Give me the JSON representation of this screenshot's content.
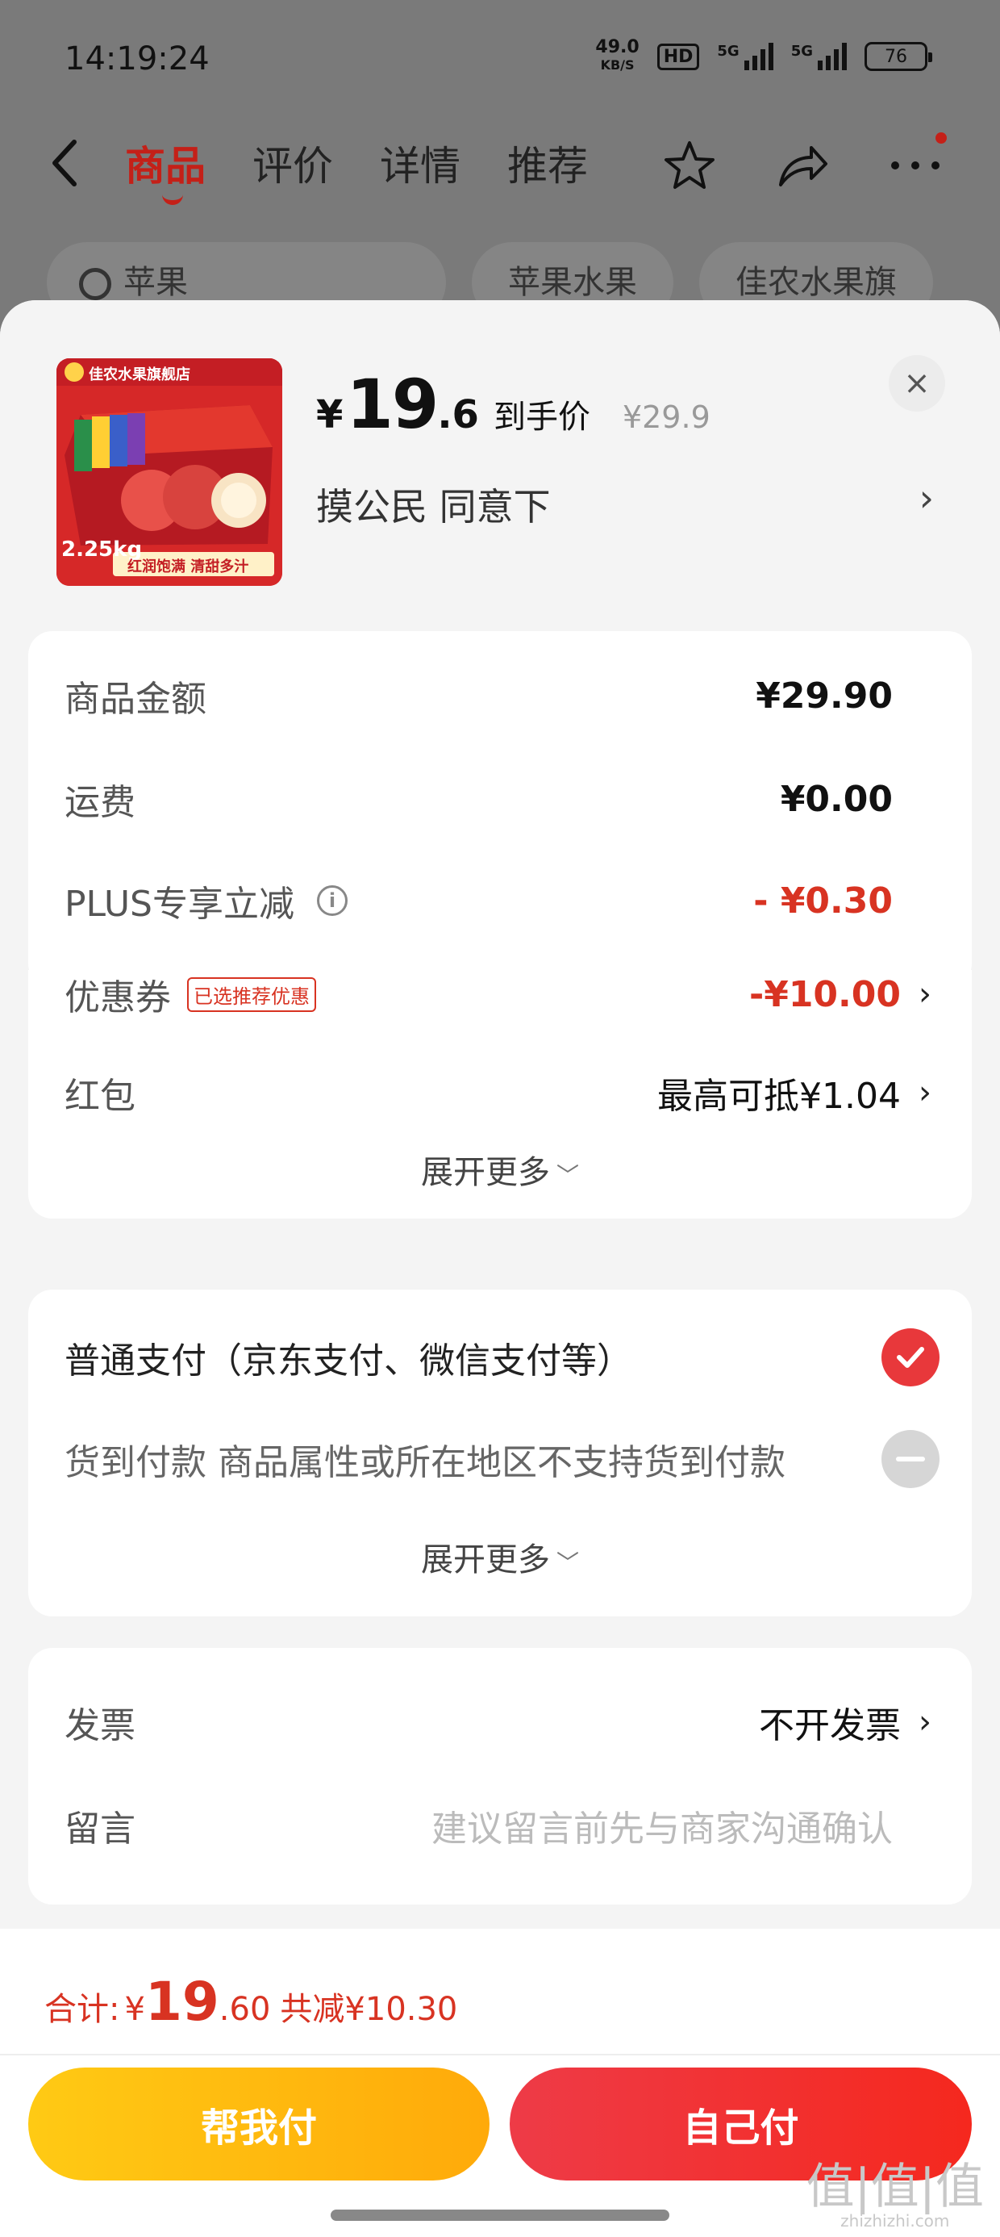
{
  "status_bar": {
    "time": "14:19:24",
    "net_speed_value": "49.0",
    "net_speed_unit": "KB/S",
    "hd": "HD",
    "sig1": "5G",
    "sig2": "5G",
    "battery": "76"
  },
  "nav": {
    "back_icon": "back-arrow-icon",
    "tabs": [
      "商品",
      "评价",
      "详情",
      "推荐"
    ],
    "active_tab": 0
  },
  "chips": {
    "search_text": "苹果",
    "chip1": "苹果水果",
    "chip2": "佳农水果旗"
  },
  "product": {
    "image_caption_1": "佳农水果旗舰店",
    "image_caption_2": "红润饱满 清甜多汁",
    "image_weight": "2.25kg",
    "yen": "¥",
    "price_int": "19",
    "price_dec": ".6",
    "price_tag": "到手价",
    "original_price": "¥29.9",
    "spec": "摸公民  同意下",
    "spec_arrow": "›",
    "close": "×"
  },
  "summary": {
    "goods_label": "商品金额",
    "goods_value": "¥29.90",
    "shipping_label": "运费",
    "shipping_value": "¥0.00",
    "plus_label": "PLUS专享立减",
    "plus_info": "i",
    "plus_value": "- ¥0.30",
    "coupon_label": "优惠券",
    "coupon_badge": "已选推荐优惠",
    "coupon_value": "-¥10.00",
    "redpacket_label": "红包",
    "redpacket_value": "最高可抵¥1.04",
    "expand": "展开更多",
    "chev": "›"
  },
  "payment": {
    "normal_label": "普通支付（京东支付、微信支付等）",
    "cod_label": "货到付款 商品属性或所在地区不支持货到付款",
    "expand": "展开更多"
  },
  "extra": {
    "invoice_label": "发票",
    "invoice_value": "不开发票",
    "message_label": "留言",
    "message_placeholder": "建议留言前先与商家沟通确认"
  },
  "footer": {
    "total_label": "合计:",
    "total_yen": "¥",
    "total_int": "19",
    "total_dec": ".60",
    "total_save": "共减¥10.30",
    "btn_help": "帮我付",
    "btn_self": "自己付"
  },
  "watermark": {
    "text": "值|值|值",
    "sub": "zhizhizhi.com"
  },
  "colors": {
    "accent_red": "#d83322",
    "jd_red": "#c42018",
    "help_yellow": "#ffb70f",
    "self_red": "#f0302b"
  }
}
